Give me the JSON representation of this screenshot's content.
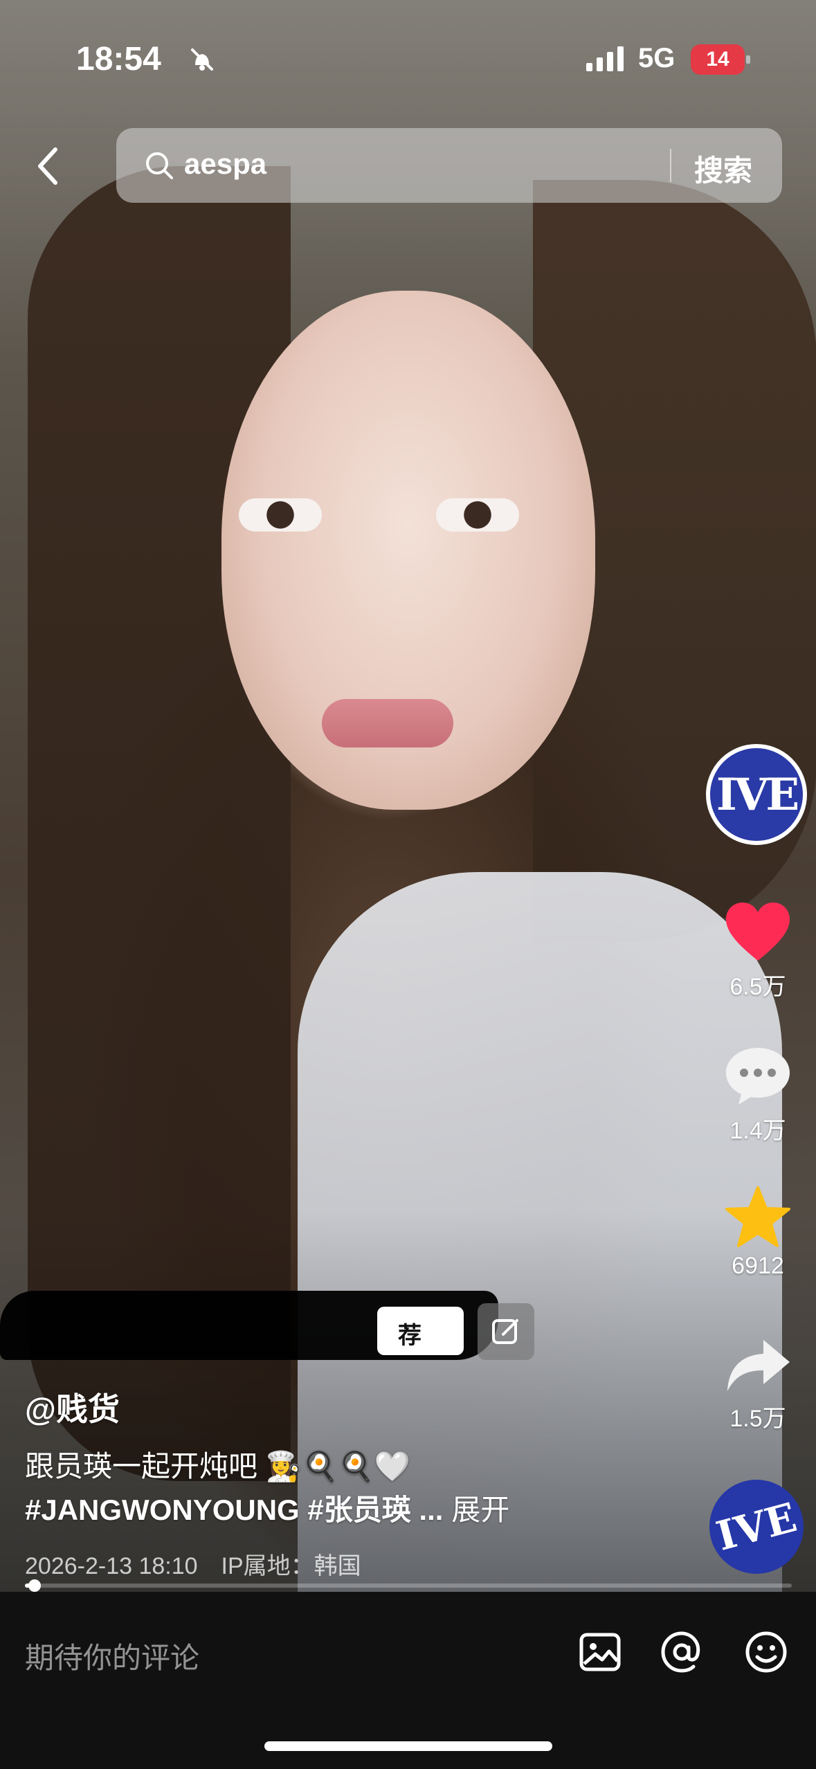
{
  "status_bar": {
    "time": "18:54",
    "network": "5G",
    "battery": "14"
  },
  "search": {
    "query": "aespa",
    "button_label": "搜索"
  },
  "right_rail": {
    "avatar_text": "IVE",
    "likes": "6.5万",
    "comments": "1.4万",
    "favorites": "6912",
    "shares": "1.5万",
    "music_disc_text": "IVE",
    "like_color": "#fe2c55",
    "favorite_color": "#fdbf12"
  },
  "overlay": {
    "tag_label": "荐",
    "author": "@贱货",
    "description_line1": "跟员瑛一起开炖吧 👩‍🍳🍳🍳🤍",
    "description_line2": "#JANGWONYOUNG #张员瑛 ...",
    "expand_label": "展开",
    "date": "2026-2-13 18:10",
    "ip_location": "IP属地：韩国"
  },
  "progress": {
    "fraction": 0.01
  },
  "bottom_bar": {
    "comment_placeholder": "期待你的评论"
  },
  "icons": {
    "back": "back-arrow-icon",
    "search": "search-icon",
    "mute": "bell-slash-icon",
    "signal": "signal-bars-icon",
    "like": "heart-icon",
    "comment": "comment-bubble-icon",
    "favorite": "star-icon",
    "share": "share-arrow-icon",
    "edit": "edit-icon",
    "image": "image-icon",
    "mention": "at-icon",
    "emoji": "emoji-icon"
  }
}
